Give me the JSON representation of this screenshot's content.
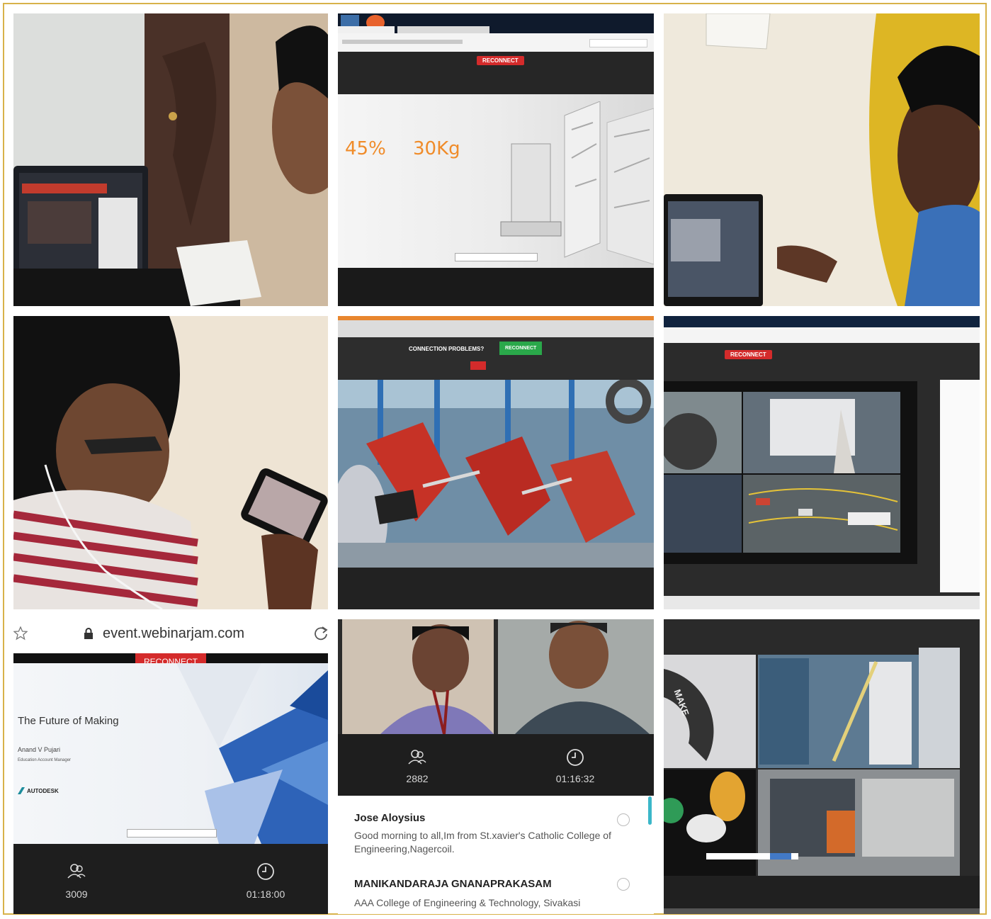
{
  "tile2": {
    "reconnect_label": "RECONNECT",
    "stat_percent": "45%",
    "stat_weight": "30Kg"
  },
  "tile5": {
    "connection_problems": "CONNECTION PROBLEMS?",
    "reconnect_label": "RECONNECT"
  },
  "tile6": {
    "reconnect_label": "RECONNECT"
  },
  "tile7": {
    "url": "event.webinarjam.com",
    "reconnect_label": "RECONNECT",
    "slide_title": "The Future of Making",
    "presenter_name": "Anand V Pujari",
    "presenter_role": "Education Account Manager",
    "brand": "AUTODESK",
    "attendees_count": "3009",
    "elapsed_time": "01:18:00"
  },
  "tile8": {
    "attendees_count": "2882",
    "elapsed_time": "01:16:32",
    "chat": [
      {
        "name": "Jose Aloysius",
        "message": "Good morning to all,Im from St.xavier's Catholic College of Engineering,Nagercoil."
      },
      {
        "name": "MANIKANDARAJA GNANAPRAKASAM",
        "message": "AAA College of Engineering & Technology, Sivakasi"
      }
    ]
  },
  "tile9": {
    "wheel_label": "MAKE"
  },
  "colors": {
    "frame_border": "#d8b24a",
    "reconnect_red": "#d42b2b",
    "stat_orange": "#f08c2a",
    "stats_bar": "#1e1e1e"
  }
}
